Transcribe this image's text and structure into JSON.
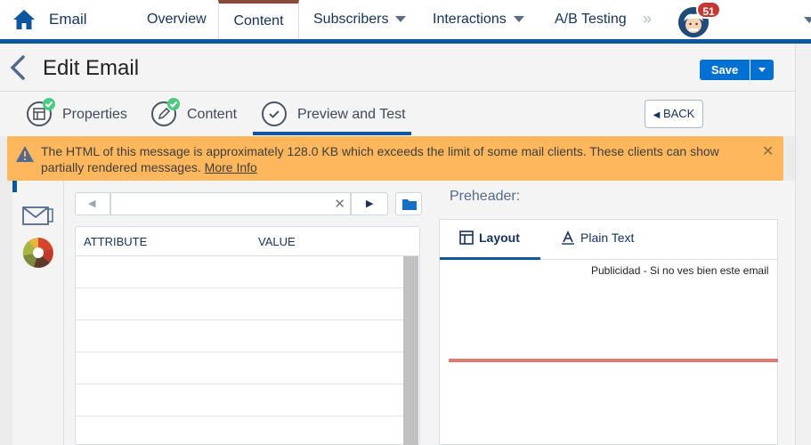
{
  "topnav": {
    "app_name": "Email",
    "tabs": [
      {
        "label": "Overview"
      },
      {
        "label": "Content"
      },
      {
        "label": "Subscribers"
      },
      {
        "label": "Interactions"
      },
      {
        "label": "A/B Testing"
      }
    ],
    "notification_count": "51"
  },
  "header": {
    "title": "Edit Email",
    "save_label": "Save"
  },
  "steps": {
    "items": [
      {
        "label": "Properties",
        "complete": true
      },
      {
        "label": "Content",
        "complete": true
      },
      {
        "label": "Preview and Test",
        "complete": false
      }
    ],
    "back_label": "BACK"
  },
  "warning": {
    "message": "The HTML of this message is approximately 128.0 KB which exceeds the limit of some mail clients. These clients can show partially rendered messages.",
    "link_label": "More Info"
  },
  "table": {
    "col_attribute": "ATTRIBUTE",
    "col_value": "VALUE"
  },
  "preview": {
    "preheader_label": "Preheader:",
    "tab_layout": "Layout",
    "tab_plain": "Plain Text",
    "pub_text": "Publicidad - Si no ves bien este email"
  },
  "colors": {
    "brand_blue": "#0e56a0",
    "save_blue": "#0070d2",
    "warning": "#ffb75d",
    "success": "#4bca81"
  }
}
